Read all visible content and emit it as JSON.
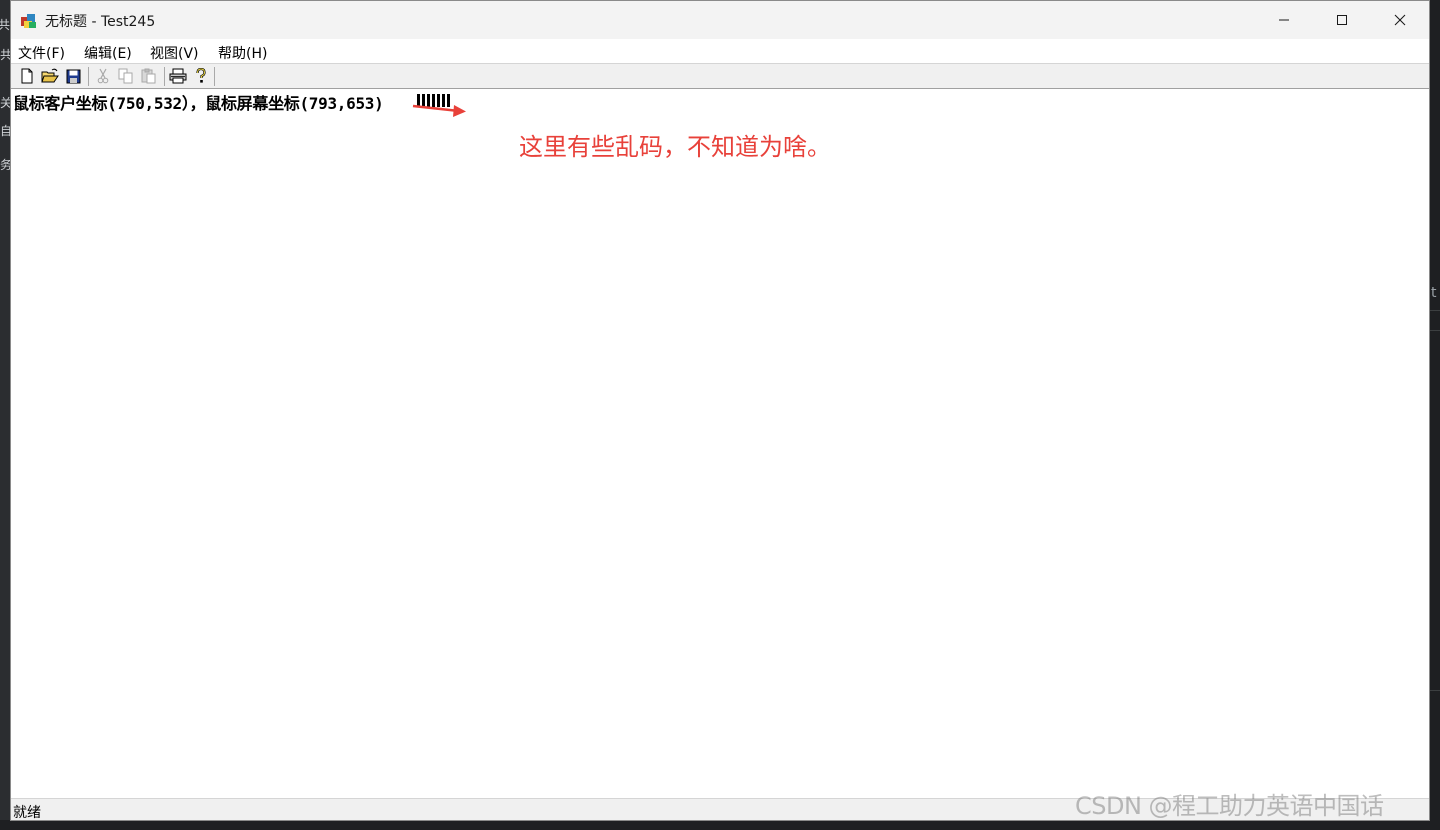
{
  "window": {
    "title": "无标题 - Test245"
  },
  "menubar": {
    "items": [
      {
        "label": "文件(F)"
      },
      {
        "label": "编辑(E)"
      },
      {
        "label": "视图(V)"
      },
      {
        "label": "帮助(H)"
      }
    ]
  },
  "toolbar": {
    "buttons": [
      {
        "icon": "new-file-icon",
        "enabled": true
      },
      {
        "icon": "open-folder-icon",
        "enabled": true
      },
      {
        "icon": "save-icon",
        "enabled": true
      },
      {
        "icon": "cut-icon",
        "enabled": false
      },
      {
        "icon": "copy-icon",
        "enabled": false
      },
      {
        "icon": "paste-icon",
        "enabled": false
      },
      {
        "icon": "print-icon",
        "enabled": true
      },
      {
        "icon": "help-icon",
        "enabled": true
      }
    ]
  },
  "client": {
    "coord_text": "鼠标客户坐标(750,532），鼠标屏幕坐标(793,653)",
    "garbled_glyph_count": 7,
    "annotation": "这里有些乱码，不知道为啥。",
    "annotation_color": "#e8413a"
  },
  "statusbar": {
    "text": "就绪"
  },
  "watermark": {
    "text": "CSDN @程工助力英语中国话"
  },
  "background": {
    "left_glyphs": [
      "共",
      "关",
      "自",
      "务"
    ],
    "right_glyph": "t"
  }
}
